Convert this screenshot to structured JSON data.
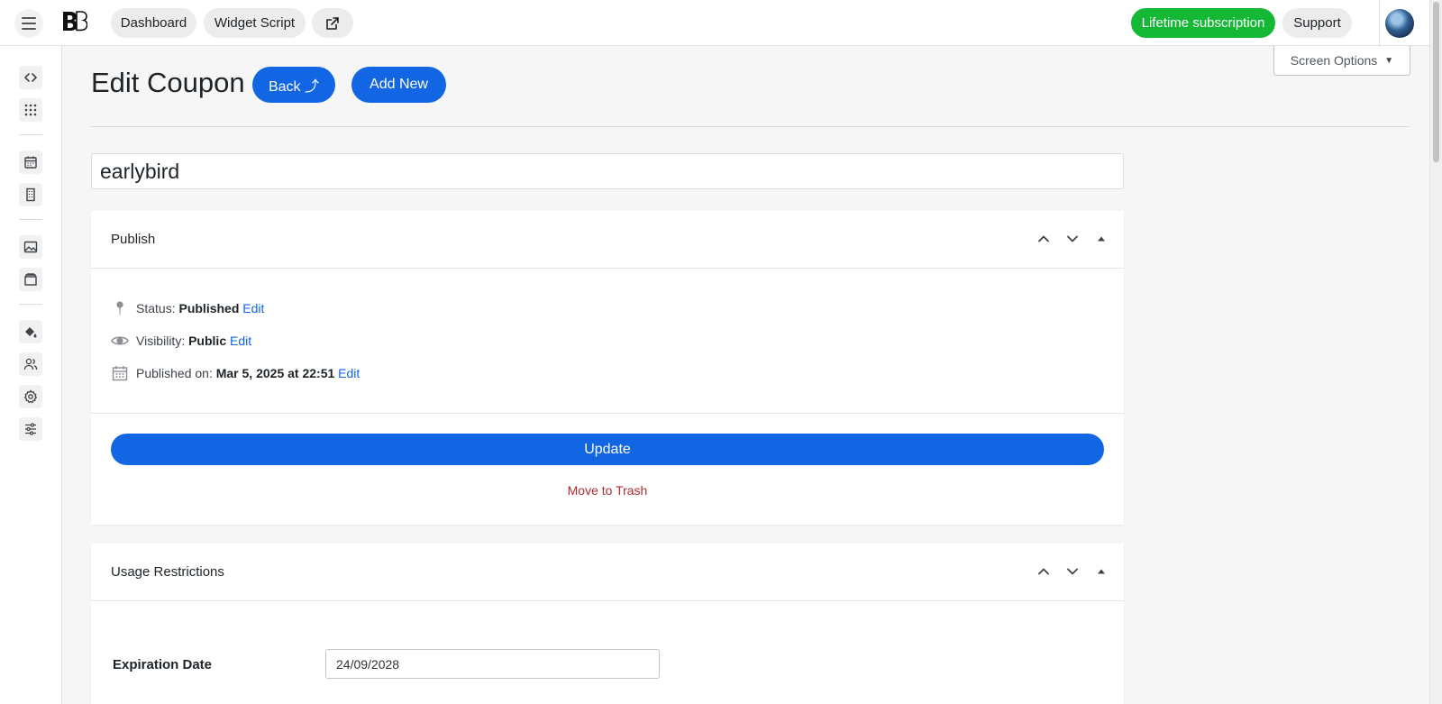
{
  "topbar": {
    "dashboard_label": "Dashboard",
    "widget_script_label": "Widget Script",
    "lifetime_label": "Lifetime subscription",
    "support_label": "Support"
  },
  "page": {
    "title": "Edit Coupon",
    "back_label": "Back ⤴",
    "add_new_label": "Add New",
    "screen_options_label": "Screen Options",
    "screen_options_arrow": "▼"
  },
  "coupon": {
    "title_value": "earlybird"
  },
  "publish": {
    "heading": "Publish",
    "status_label": "Status:",
    "status_value": "Published",
    "visibility_label": "Visibility:",
    "visibility_value": "Public",
    "published_label": "Published on:",
    "published_value": "Mar 5, 2025 at 22:51",
    "edit_label": "Edit",
    "update_label": "Update",
    "trash_label": "Move to Trash"
  },
  "usage": {
    "heading": "Usage Restrictions",
    "expiration_label": "Expiration Date",
    "expiration_value": "24/09/2028"
  },
  "colors": {
    "accent": "#1266e3",
    "success": "#14b834",
    "danger": "#b32d2e"
  },
  "icons": {
    "sidebar": [
      "code-icon",
      "apps-grid-icon",
      "calendar-icon",
      "building-icon",
      "image-icon",
      "archive-icon",
      "paint-bucket-icon",
      "users-icon",
      "gear-icon",
      "sliders-icon"
    ]
  }
}
